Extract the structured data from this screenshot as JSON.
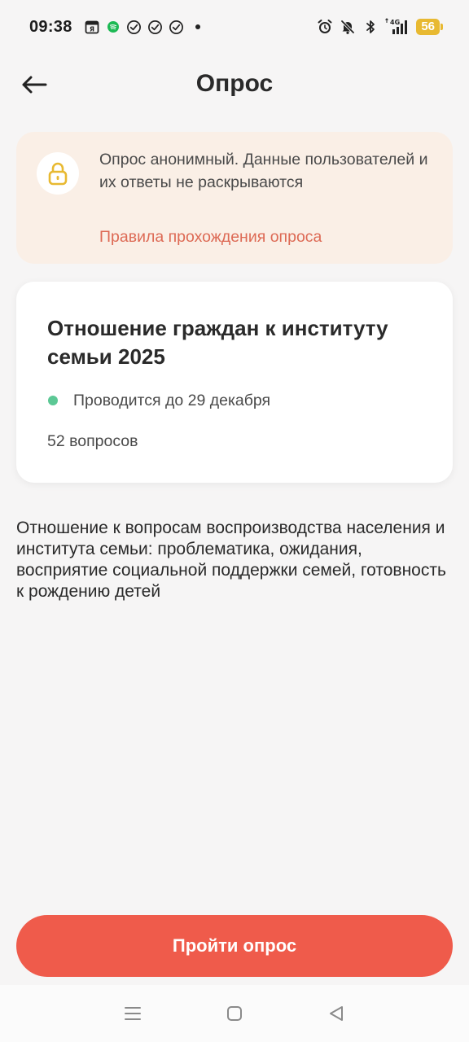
{
  "status_bar": {
    "time": "09:38",
    "network": "4G",
    "battery": "56"
  },
  "header": {
    "title": "Опрос",
    "back_icon": "arrow-left-icon"
  },
  "notice": {
    "text": "Опрос анонимный. Данные пользователей и их ответы не раскрываются",
    "link": "Правила прохождения опроса",
    "icon": "lock-icon"
  },
  "survey": {
    "title": "Отношение граждан к институту семьи 2025",
    "deadline": "Проводится до 29 декабря",
    "questions": "52 вопросов",
    "status_color": "#5cc895"
  },
  "description": "Отношение к вопросам воспроизводства населения и института семьи: проблематика, ожидания, восприятие социальной поддержки семей, готовность к рождению детей",
  "action": {
    "start_label": "Пройти опрос",
    "color": "#ef5b4b"
  },
  "colors": {
    "accent": "#ef5b4b",
    "link": "#dd6a55",
    "notice_bg": "#faefe6",
    "lock": "#e8b931"
  }
}
